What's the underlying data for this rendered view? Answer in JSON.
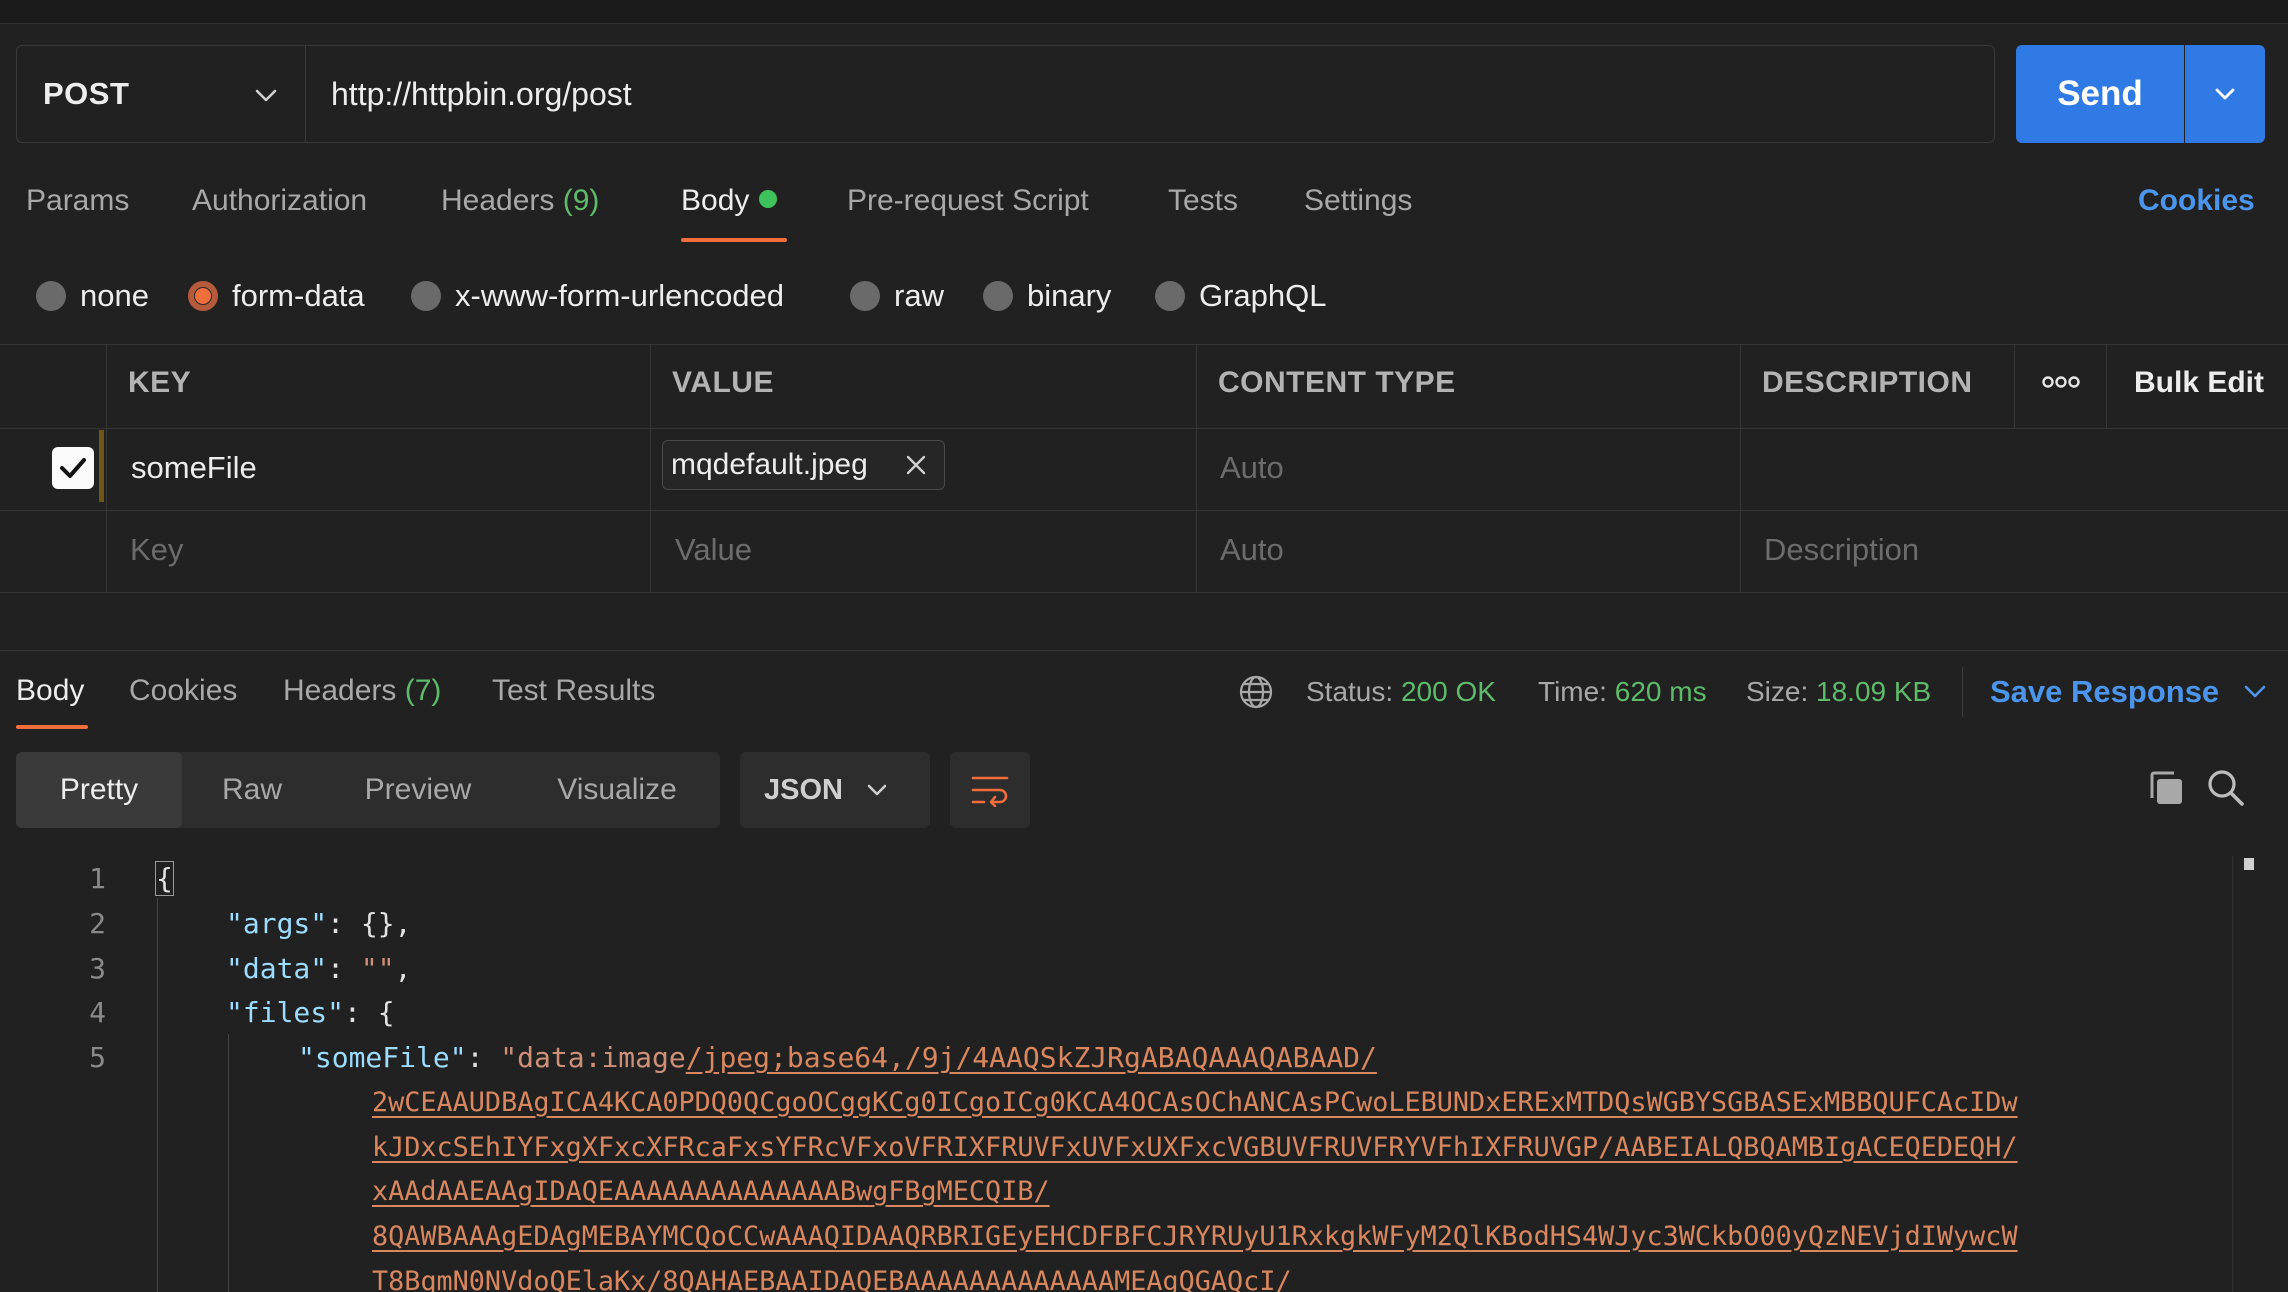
{
  "request": {
    "method": "POST",
    "url": "http://httpbin.org/post",
    "send_label": "Send"
  },
  "request_tabs": {
    "params": "Params",
    "authorization": "Authorization",
    "headers": "Headers",
    "headers_count": "(9)",
    "body": "Body",
    "pre_request": "Pre-request Script",
    "tests": "Tests",
    "settings": "Settings",
    "cookies": "Cookies"
  },
  "body_types": {
    "none": "none",
    "form_data": "form-data",
    "urlencoded": "x-www-form-urlencoded",
    "raw": "raw",
    "binary": "binary",
    "graphql": "GraphQL",
    "selected": "form-data"
  },
  "table": {
    "headers": {
      "key": "KEY",
      "value": "VALUE",
      "content_type": "CONTENT TYPE",
      "description": "DESCRIPTION"
    },
    "more_label": "ooo",
    "bulk_edit": "Bulk Edit",
    "rows": [
      {
        "key": "someFile",
        "value": "mqdefault.jpeg",
        "content_type_placeholder": "Auto"
      }
    ],
    "new_row": {
      "key_placeholder": "Key",
      "value_placeholder": "Value",
      "content_type_placeholder": "Auto",
      "description_placeholder": "Description"
    }
  },
  "response": {
    "tabs": {
      "body": "Body",
      "cookies": "Cookies",
      "headers": "Headers",
      "headers_count": "(7)",
      "test_results": "Test Results"
    },
    "status_label": "Status:",
    "status_value": "200 OK",
    "time_label": "Time:",
    "time_value": "620 ms",
    "size_label": "Size:",
    "size_value": "18.09 KB",
    "save_response": "Save Response",
    "views": {
      "pretty": "Pretty",
      "raw": "Raw",
      "preview": "Preview",
      "visualize": "Visualize"
    },
    "format": "JSON"
  },
  "code": {
    "line_numbers": [
      "1",
      "2",
      "3",
      "4",
      "5"
    ],
    "l1": "{",
    "l2_key": "\"args\"",
    "l2_rest": ": {},",
    "l3_key": "\"data\"",
    "l3_colon": ": ",
    "l3_val": "\"\"",
    "l3_comma": ",",
    "l4_key": "\"files\"",
    "l4_rest": ": {",
    "l5_key": "\"someFile\"",
    "l5_colon": ": ",
    "l5_val_start": "\"data:image",
    "l5_val_link": "/jpeg;base64,/9j/4AAQSkZJRgABAQAAAQABAAD/",
    "w1": "2wCEAAUDBAgICA4KCA0PDQ0QCgoOCggKCg0ICgoICg0KCA4OCAsOChANCAsPCwoLEBUNDxERExMTDQsWGBYSGBASExMBBQUFCAcIDw",
    "w2": "kJDxcSEhIYFxgXFxcXFRcaFxsYFRcVFxoVFRIXFRUVFxUVFxUXFxcVGBUVFRUVFRYVFhIXFRUVGP/AABEIALQBQAMBIgACEQEDEQH/",
    "w3": "xAAdAAEAAgIDAQEAAAAAAAAAAAAAABwgFBgMECQIB/",
    "w4": "8QAWBAAAgEDAgMEBAYMCQoCCwAAAQIDAAQRBRIGEyEHCDFBFCJRYRUyU1RxkgkWFyM2QlKBodHS4WJyc3WCkbO00yQzNEVjdIWywcW",
    "w5": "T8BqmN0NVdoQElaKx/8QAHAEBAAIDAQEBAAAAAAAAAAAAAMEAgQGAQcI/"
  }
}
